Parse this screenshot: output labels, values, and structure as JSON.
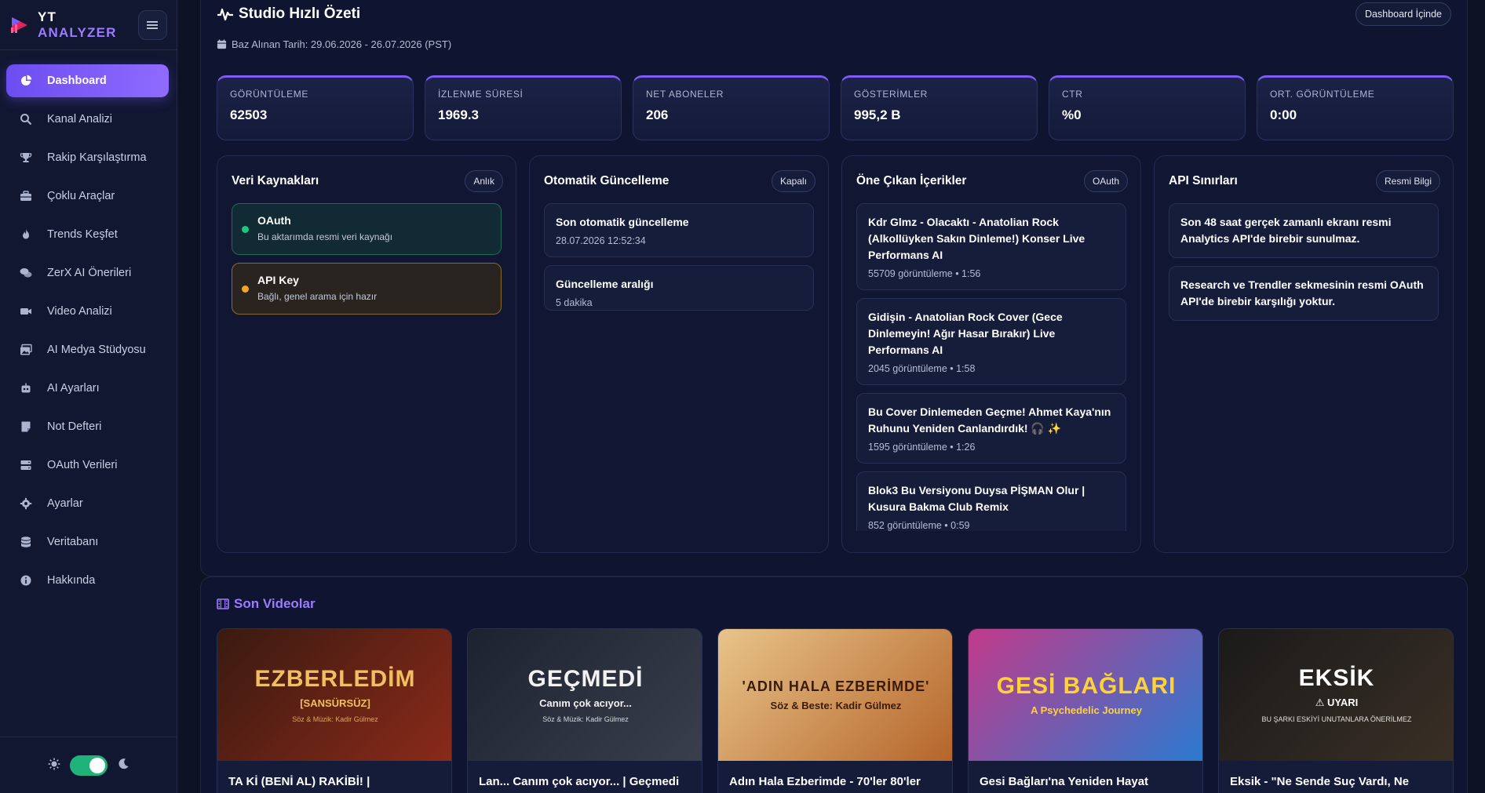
{
  "brand": {
    "title_main": "YT ",
    "title_accent": "ANALYZER"
  },
  "nav": [
    {
      "label": "Dashboard",
      "icon": "dashboard-icon",
      "active": true
    },
    {
      "label": "Kanal Analizi",
      "icon": "search-icon"
    },
    {
      "label": "Rakip Karşılaştırma",
      "icon": "trophy-icon"
    },
    {
      "label": "Çoklu Araçlar",
      "icon": "toolbox-icon"
    },
    {
      "label": "Trends Keşfet",
      "icon": "fire-icon"
    },
    {
      "label": "ZerX AI Önerileri",
      "icon": "chat-icon"
    },
    {
      "label": "Video Analizi",
      "icon": "video-icon"
    },
    {
      "label": "AI Medya Stüdyosu",
      "icon": "images-icon"
    },
    {
      "label": "AI Ayarları",
      "icon": "robot-icon"
    },
    {
      "label": "Not Defteri",
      "icon": "note-icon"
    },
    {
      "label": "OAuth Verileri",
      "icon": "server-icon"
    },
    {
      "label": "Ayarlar",
      "icon": "gear-icon"
    },
    {
      "label": "Veritabanı",
      "icon": "database-icon"
    },
    {
      "label": "Hakkında",
      "icon": "info-icon"
    }
  ],
  "header": {
    "title": "Studio Hızlı Özeti",
    "badge": "Dashboard İçinde",
    "date": "Baz Alınan Tarih: 29.06.2026 - 26.07.2026 (PST)"
  },
  "stats": [
    {
      "label": "GÖRÜNTÜLEME",
      "value": "62503"
    },
    {
      "label": "İZLENME SÜRESİ",
      "value": "1969.3"
    },
    {
      "label": "NET ABONELER",
      "value": "206"
    },
    {
      "label": "GÖSTERİMLER",
      "value": "995,2 B"
    },
    {
      "label": "CTR",
      "value": "%0"
    },
    {
      "label": "ORT. GÖRÜNTÜLEME",
      "value": "0:00"
    }
  ],
  "sources": {
    "title": "Veri Kaynakları",
    "pill": "Anlık",
    "oauth": {
      "title": "OAuth",
      "sub": "Bu aktarımda resmi veri kaynağı"
    },
    "api": {
      "title": "API Key",
      "sub": "Bağlı, genel arama için hazır"
    }
  },
  "auto": {
    "title": "Otomatik Güncelleme",
    "pill": "Kapalı",
    "items": [
      {
        "title": "Son otomatik güncelleme",
        "sub": "28.07.2026 12:52:34"
      },
      {
        "title": "Güncelleme aralığı",
        "sub": "5 dakika"
      }
    ]
  },
  "highlights": {
    "title": "Öne Çıkan İçerikler",
    "pill": "OAuth",
    "items": [
      {
        "title": "Kdr Glmz - Olacaktı - Anatolian Rock (Alkollüyken Sakın Dinleme!) Konser Live Performans AI",
        "sub": "55709 görüntüleme • 1:56"
      },
      {
        "title": "Gidişin - Anatolian Rock Cover (Gece Dinlemeyin! Ağır Hasar Bırakır) Live Performans AI",
        "sub": "2045 görüntüleme • 1:58"
      },
      {
        "title": "Bu Cover Dinlemeden Geçme! Ahmet Kaya'nın Ruhunu Yeniden Canlandırdık! 🎧 ✨",
        "sub": "1595 görüntüleme • 1:26"
      },
      {
        "title": "Blok3 Bu Versiyonu Duysa PİŞMAN Olur | Kusura Bakma Club Remix",
        "sub": "852 görüntüleme • 0:59"
      }
    ]
  },
  "limits": {
    "title": "API Sınırları",
    "pill": "Resmi Bilgi",
    "items": [
      {
        "title": "Son 48 saat gerçek zamanlı ekranı resmi Analytics API'de birebir sunulmaz."
      },
      {
        "title": "Research ve Trendler sekmesinin resmi OAuth API'de birebir karşılığı yoktur."
      }
    ]
  },
  "videos": {
    "title": "Son Videolar",
    "items": [
      {
        "thumb_text": "EZBERLEDİM",
        "thumb_sub": "[SANSÜRSÜZ]",
        "thumb_credit": "Söz & Müzik: Kadir Gülmez",
        "title": "TA Kİ (BENİ AL) RAKİBİ! |",
        "colors": [
          "#3a1a10",
          "#8a2a1a"
        ],
        "text_color": "#f0c060"
      },
      {
        "thumb_text": "GEÇMEDİ",
        "thumb_sub": "Canım çok acıyor...",
        "thumb_credit": "Söz & Müzik: Kadir Gülmez",
        "title": "Lan... Canım çok acıyor... | Geçmedi",
        "colors": [
          "#1d2230",
          "#3a3f4c"
        ],
        "text_color": "#f2f2f2"
      },
      {
        "thumb_text": "'ADIN HALA EZBERİMDE'",
        "thumb_sub": "Söz & Beste: Kadir Gülmez",
        "thumb_credit": "",
        "title": "Adın Hala Ezberimde - 70'ler 80'ler",
        "colors": [
          "#e8c48a",
          "#b5652a"
        ],
        "text_color": "#3a1a0a"
      },
      {
        "thumb_text": "GESİ BAĞLARI",
        "thumb_sub": "A Psychedelic Journey",
        "thumb_credit": "",
        "title": "Gesi Bağları'na Yeniden Hayat",
        "colors": [
          "#c23a8a",
          "#2a7ad0"
        ],
        "text_color": "#ffd23a"
      },
      {
        "thumb_text": "EKSİK",
        "thumb_sub": "⚠ UYARI",
        "thumb_credit": "BU ŞARKI ESKİYİ UNUTANLARA ÖNERİLMEZ",
        "title": "Eksik - \"Ne Sende Suç Vardı, Ne",
        "colors": [
          "#1a1a1a",
          "#3a2f25"
        ],
        "text_color": "#ffffff"
      }
    ]
  }
}
